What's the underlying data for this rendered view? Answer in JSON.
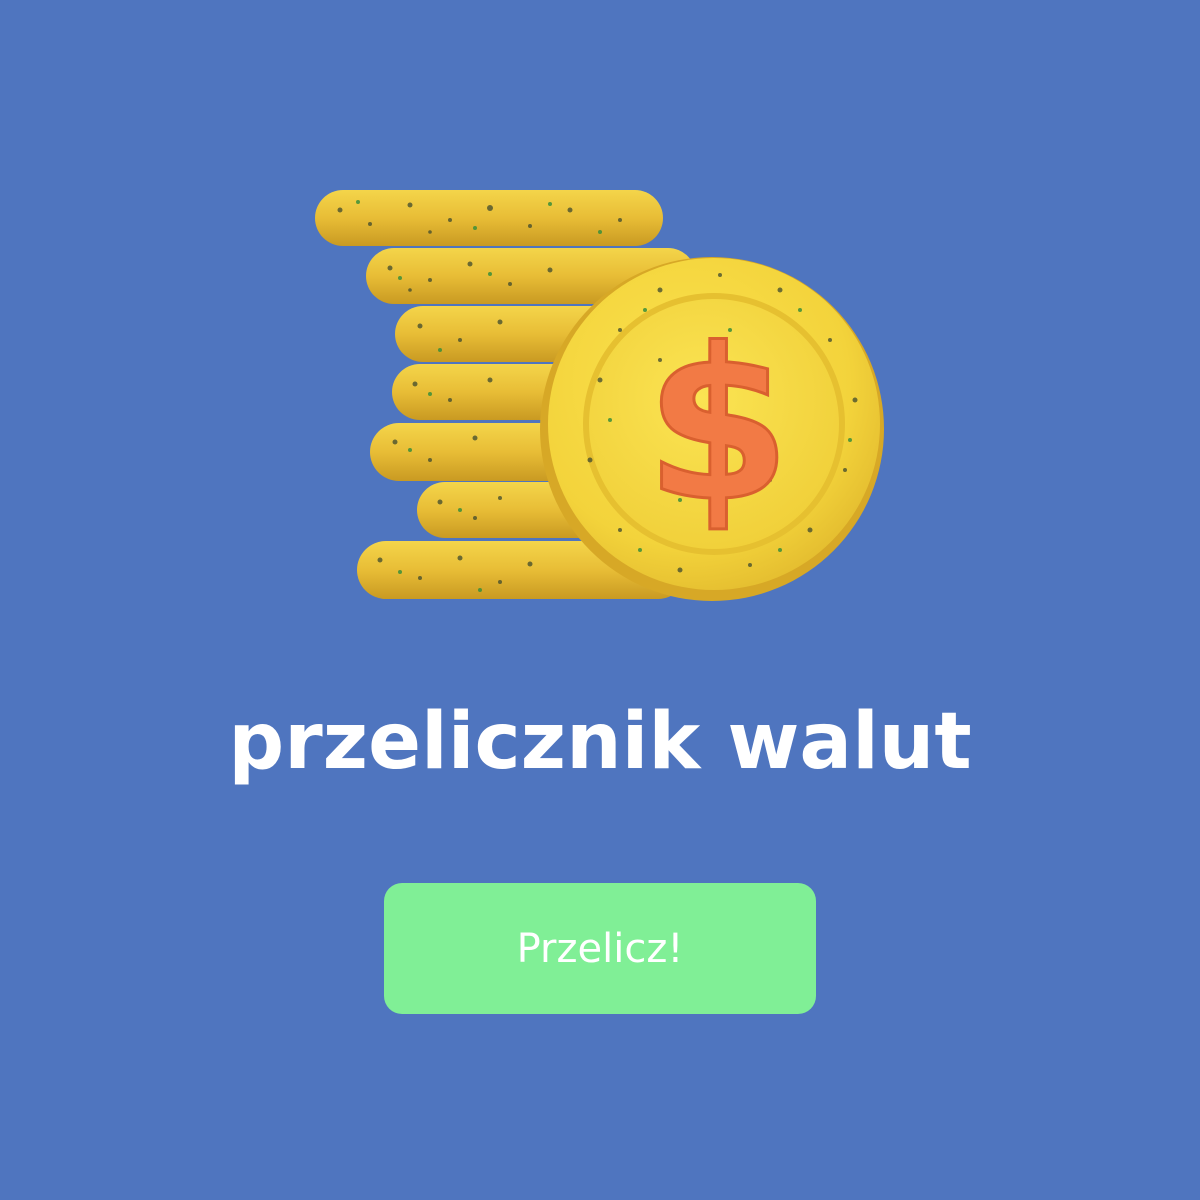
{
  "hero": {
    "illustration": "coin-stack-dollar-icon",
    "symbol": "$"
  },
  "title": "przelicznik walut",
  "button": {
    "label": "Przelicz!"
  },
  "colors": {
    "background": "#4f75bf",
    "coin_yellow": "#f5d53a",
    "coin_edge": "#e2b52c",
    "dollar_orange": "#f27a45",
    "button_green": "#80ef96",
    "text_white": "#ffffff"
  }
}
